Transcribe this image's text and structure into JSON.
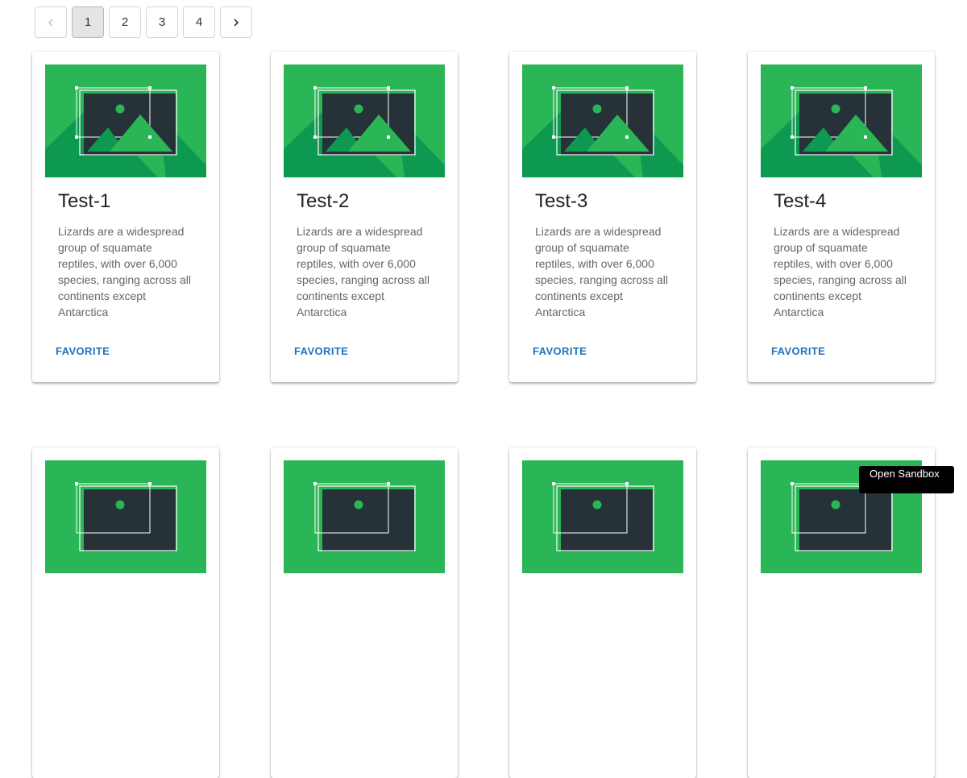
{
  "pagination": {
    "prev_icon": "chevron-left-icon",
    "next_icon": "chevron-right-icon",
    "pages": [
      "1",
      "2",
      "3",
      "4"
    ],
    "current": "1"
  },
  "colors": {
    "image_green": "#2ab656",
    "image_dark_green": "#0d9a50",
    "image_frame_dark": "#263238",
    "link_blue": "#1e73be"
  },
  "cards": [
    {
      "title": "Test-1",
      "description": "Lizards are a widespread group of squamate reptiles, with over 6,000 species, ranging across all continents except Antarctica",
      "action": "Favorite",
      "image_icon": "image-placeholder-icon"
    },
    {
      "title": "Test-2",
      "description": "Lizards are a widespread group of squamate reptiles, with over 6,000 species, ranging across all continents except Antarctica",
      "action": "Favorite",
      "image_icon": "image-placeholder-icon"
    },
    {
      "title": "Test-3",
      "description": "Lizards are a widespread group of squamate reptiles, with over 6,000 species, ranging across all continents except Antarctica",
      "action": "Favorite",
      "image_icon": "image-placeholder-icon"
    },
    {
      "title": "Test-4",
      "description": "Lizards are a widespread group of squamate reptiles, with over 6,000 species, ranging across all continents except Antarctica",
      "action": "Favorite",
      "image_icon": "image-placeholder-icon"
    }
  ],
  "sandbox_button": {
    "label": "Open Sandbox"
  }
}
